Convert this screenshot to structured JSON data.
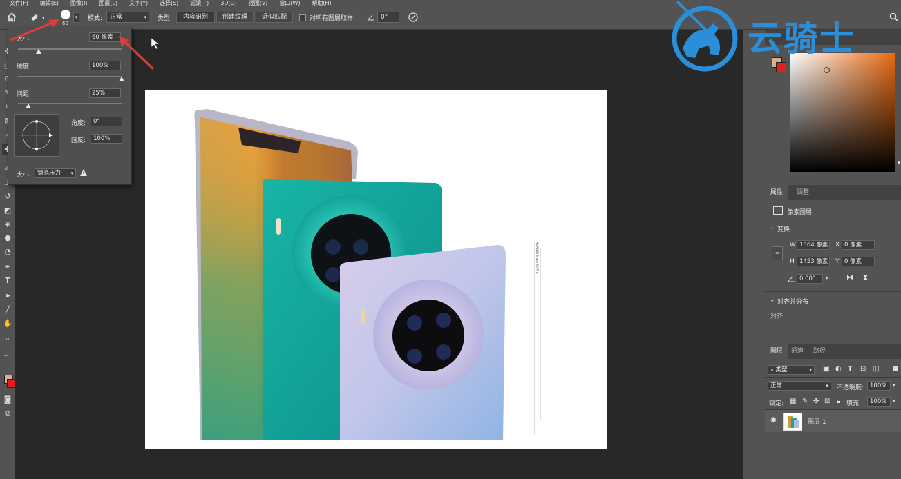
{
  "menubar": {
    "items": [
      "文件(F)",
      "编辑(E)",
      "图像(I)",
      "图层(L)",
      "文字(Y)",
      "选择(S)",
      "滤镜(T)",
      "3D(D)",
      "视图(V)",
      "窗口(W)",
      "帮助(H)"
    ]
  },
  "options": {
    "home_icon": "home-icon",
    "tool_icon": "spot-healing-brush-icon",
    "brush_size_preview": "60",
    "mode_label": "模式:",
    "mode_value": "正常",
    "type_label": "类型:",
    "type_buttons": [
      "内容识别",
      "创建纹理",
      "近似匹配"
    ],
    "sample_all_layers": "对所有图层取样",
    "angle_value": "0°",
    "search_icon": "search-icon"
  },
  "brush_popup": {
    "size_label": "大小:",
    "size_value": "60 像素",
    "size_slider": 0.2,
    "hardness_label": "硬度:",
    "hardness_value": "100%",
    "hardness_slider": 1.0,
    "spacing_label": "间距:",
    "spacing_value": "25%",
    "spacing_slider": 0.1,
    "angle_label": "角度:",
    "angle_value": "0°",
    "roundness_label": "圆度:",
    "roundness_value": "100%",
    "pressure_label": "大小:",
    "pressure_value": "钢笔压力"
  },
  "watermark": {
    "text": "云骑士",
    "color": "#2a8fd8"
  },
  "color_panel": {
    "fg_color": "#d8b08c",
    "bg_color": "#e02020",
    "hue_color": "#e86a10"
  },
  "properties_panel": {
    "tabs": [
      "属性",
      "调整"
    ],
    "layer_type": "像素图层",
    "transform_title": "变换",
    "w_label": "W",
    "w_value": "1864 像素",
    "h_label": "H",
    "h_value": "1453 像素",
    "x_label": "X",
    "x_value": "0 像素",
    "y_label": "Y",
    "y_value": "0 像素",
    "angle_value": "0.00°",
    "align_title": "对齐并分布",
    "align_label": "对齐:"
  },
  "layers_panel": {
    "tabs": [
      "图层",
      "通道",
      "路径"
    ],
    "filter_label": "类型",
    "blend_mode": "正常",
    "opacity_label": "不透明度:",
    "opacity_value": "100%",
    "lock_label": "锁定:",
    "fill_label": "填充:",
    "fill_value": "100%",
    "layer_name": "图层 1"
  },
  "document": {
    "image_caption": "HUAWEI Mate 30 Pro"
  }
}
